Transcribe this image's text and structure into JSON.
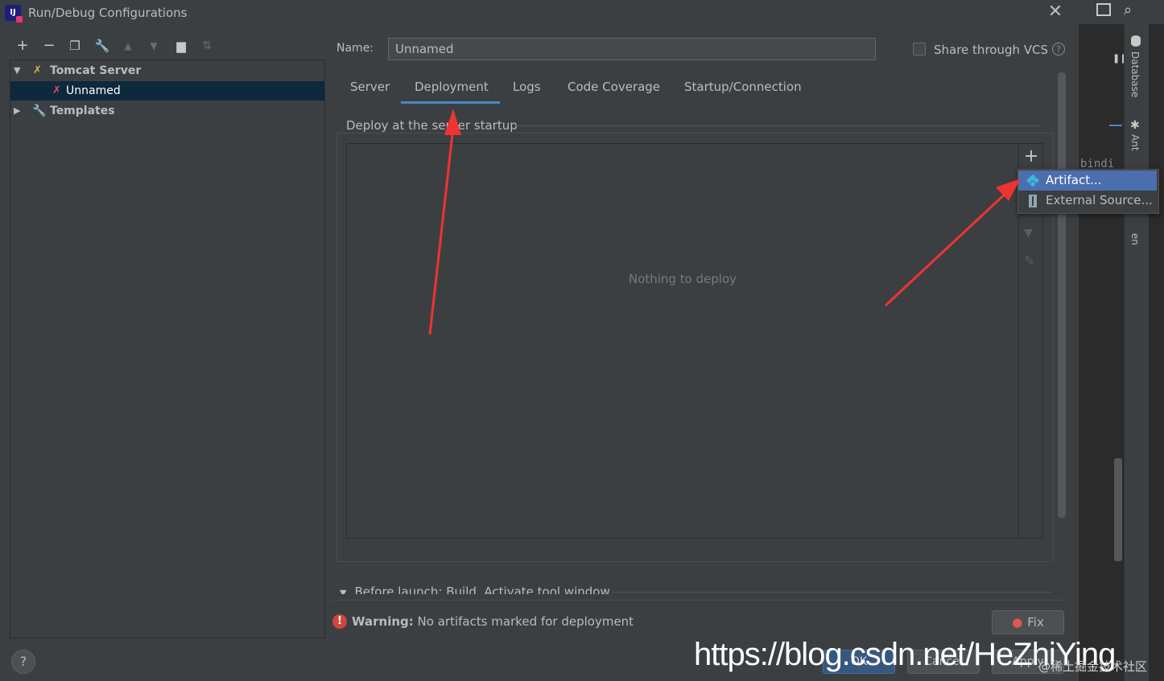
{
  "window": {
    "title": "Run/Debug Configurations"
  },
  "ide": {
    "database_label": "Database",
    "ant_label": "Ant",
    "maven_label": "en",
    "code_snippet": "bindi"
  },
  "toolbar": {
    "icons": [
      "add-icon",
      "remove-icon",
      "copy-icon",
      "wrench-icon",
      "move-up-icon",
      "move-down-icon",
      "new-folder-icon",
      "sort-icon"
    ]
  },
  "tree": {
    "tomcat_label": "Tomcat Server",
    "unnamed_label": "Unnamed",
    "templates_label": "Templates"
  },
  "form": {
    "name_label": "Name:",
    "name_value": "Unnamed",
    "share_label": "Share through VCS",
    "help_glyph": "?"
  },
  "tabs": [
    {
      "label": "Server"
    },
    {
      "label": "Deployment"
    },
    {
      "label": "Logs"
    },
    {
      "label": "Code Coverage"
    },
    {
      "label": "Startup/Connection"
    }
  ],
  "deploy": {
    "group_title": "Deploy at the server startup",
    "empty_text": "Nothing to deploy"
  },
  "popup": {
    "artifact_label": "Artifact...",
    "external_label": "External Source..."
  },
  "before_launch": {
    "label": "Before launch: Build, Activate tool window"
  },
  "warning": {
    "bold": "Warning:",
    "text": "No artifacts marked for deployment",
    "fix_label": "Fix"
  },
  "buttons": {
    "ok": "OK",
    "cancel": "Cancel",
    "apply": "Apply",
    "help": "?"
  },
  "watermark": {
    "url": "https://blog.csdn.net/HeZhiYing",
    "sub": "@稀土掘金技术社区"
  },
  "colors": {
    "accent": "#4a88c7",
    "selection": "#4b6eaf",
    "tree_selection": "#0d293e",
    "arrow": "#ee3333"
  }
}
